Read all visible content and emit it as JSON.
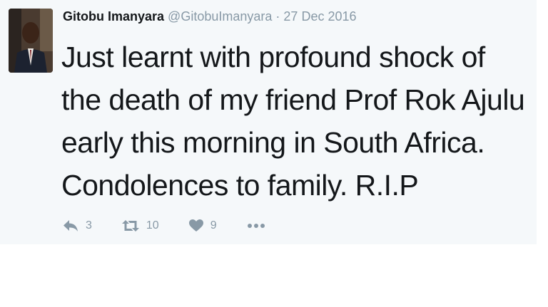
{
  "tweet": {
    "author_name": "Gitobu Imanyara",
    "handle": "@GitobuImanyara",
    "separator": "·",
    "date": "27 Dec 2016",
    "text": "Just learnt with profound shock of the death of my friend Prof Rok Ajulu early this morning in South Africa. Condolences to family. R.I.P",
    "avatar": "author-photo"
  },
  "actions": {
    "reply": {
      "icon": "reply-icon",
      "count": "3"
    },
    "retweet": {
      "icon": "retweet-icon",
      "count": "10"
    },
    "like": {
      "icon": "heart-icon",
      "count": "9"
    },
    "more": {
      "icon": "more-icon"
    }
  },
  "colors": {
    "card_background": "#f5f8fa",
    "text": "#14171a",
    "muted": "#8899a6"
  }
}
